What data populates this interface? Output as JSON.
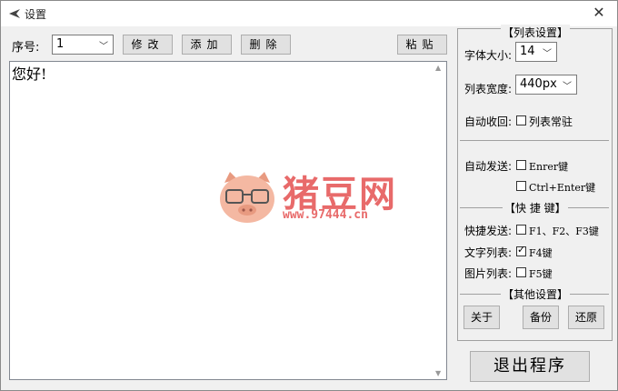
{
  "window": {
    "title": "设置",
    "close_glyph": "✕"
  },
  "toolbar": {
    "seq_label": "序号:",
    "seq_value": "1",
    "modify_label": "修改",
    "add_label": "添加",
    "delete_label": "删除",
    "paste_label": "粘贴"
  },
  "editor": {
    "content": "您好!"
  },
  "watermark": {
    "brand": "猪豆网",
    "url": "www.97444.cn"
  },
  "list_settings": {
    "header": "【列表设置】",
    "font_size_label": "字体大小:",
    "font_size_value": "14",
    "width_label": "列表宽度:",
    "width_value": "440px",
    "auto_collapse_label": "自动收回:",
    "pin_list_label": "列表常驻",
    "pin_list_checked": false
  },
  "auto_send": {
    "label": "自动发送:",
    "enter_label": "Enrer键",
    "enter_checked": false,
    "ctrl_enter_label": "Ctrl+Enter键",
    "ctrl_enter_checked": false
  },
  "hotkeys": {
    "header": "【快 捷 键】",
    "quick_send_label": "快捷发送:",
    "quick_send_value": "F1、F2、F3键",
    "quick_send_checked": false,
    "text_list_label": "文字列表:",
    "text_list_value": "F4键",
    "text_list_checked": true,
    "image_list_label": "图片列表:",
    "image_list_value": "F5键",
    "image_list_checked": false
  },
  "other": {
    "header": "【其他设置】",
    "about_label": "关于",
    "backup_label": "备份",
    "restore_label": "还原"
  },
  "exit_label": "退出程序",
  "colors": {
    "watermark": "#e86a6a",
    "pig": "#f0a48a"
  }
}
